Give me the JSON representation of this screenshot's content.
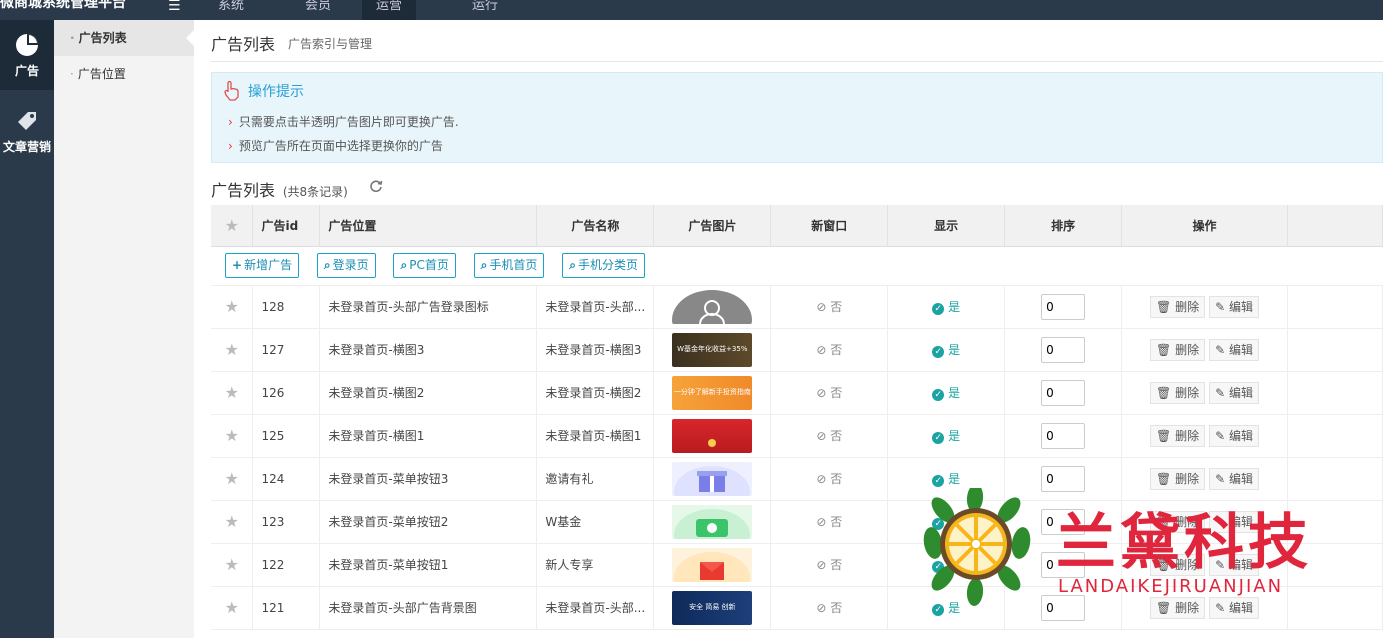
{
  "topbar": {
    "brand": "微商城系统管理平台",
    "tabs": [
      "系统",
      "会员",
      "运营",
      "运行"
    ]
  },
  "sidebar": {
    "items": [
      {
        "label": "广告",
        "icon": "pie-chart-icon",
        "active": true
      },
      {
        "label": "文章营销",
        "icon": "tag-icon",
        "active": false
      }
    ]
  },
  "subnav": {
    "items": [
      {
        "label": "广告列表",
        "active": true
      },
      {
        "label": "广告位置",
        "active": false
      }
    ]
  },
  "page": {
    "title": "广告列表",
    "subtitle": "广告索引与管理"
  },
  "tips": {
    "title": "操作提示",
    "lines": [
      "只需要点击半透明广告图片即可更换广告.",
      "预览广告所在页面中选择更换你的广告"
    ]
  },
  "list": {
    "title": "广告列表",
    "count": "(共8条记录)",
    "headers": [
      "广告id",
      "广告位置",
      "广告名称",
      "广告图片",
      "新窗口",
      "显示",
      "排序",
      "操作"
    ],
    "toolbar": [
      {
        "label": "新增广告",
        "icon": "plus-icon"
      },
      {
        "label": "登录页",
        "icon": "search-icon"
      },
      {
        "label": "PC首页",
        "icon": "search-icon"
      },
      {
        "label": "手机首页",
        "icon": "search-icon"
      },
      {
        "label": "手机分类页",
        "icon": "search-icon"
      }
    ],
    "no_label": "否",
    "yes_label": "是",
    "delete_label": "删除",
    "edit_label": "编辑",
    "rows": [
      {
        "id": "128",
        "position": "未登录首页-头部广告登录图标",
        "name": "未登录首页-头部...",
        "order": "0",
        "thumb": "avatar-gray"
      },
      {
        "id": "127",
        "position": "未登录首页-横图3",
        "name": "未登录首页-横图3",
        "order": "0",
        "thumb": "banner-dark",
        "thumb_text": "W基金年化收益+35%"
      },
      {
        "id": "126",
        "position": "未登录首页-横图2",
        "name": "未登录首页-横图2",
        "order": "0",
        "thumb": "banner-orange",
        "thumb_text": "一分钟了解新手投资指南"
      },
      {
        "id": "125",
        "position": "未登录首页-横图1",
        "name": "未登录首页-横图1",
        "order": "0",
        "thumb": "banner-red"
      },
      {
        "id": "124",
        "position": "未登录首页-菜单按钮3",
        "name": "邀请有礼",
        "order": "0",
        "thumb": "gift-purple"
      },
      {
        "id": "123",
        "position": "未登录首页-菜单按钮2",
        "name": "W基金",
        "order": "0",
        "thumb": "wallet-green"
      },
      {
        "id": "122",
        "position": "未登录首页-菜单按钮1",
        "name": "新人专享",
        "order": "0",
        "thumb": "envelope-red"
      },
      {
        "id": "121",
        "position": "未登录首页-头部广告背景图",
        "name": "未登录首页-头部...",
        "order": "0",
        "thumb": "navy-banner",
        "thumb_text": "安全  简易  创新"
      }
    ]
  },
  "watermark": {
    "title": "兰黛科技",
    "subtitle": "LANDAIKEJIRUANJIAN"
  }
}
